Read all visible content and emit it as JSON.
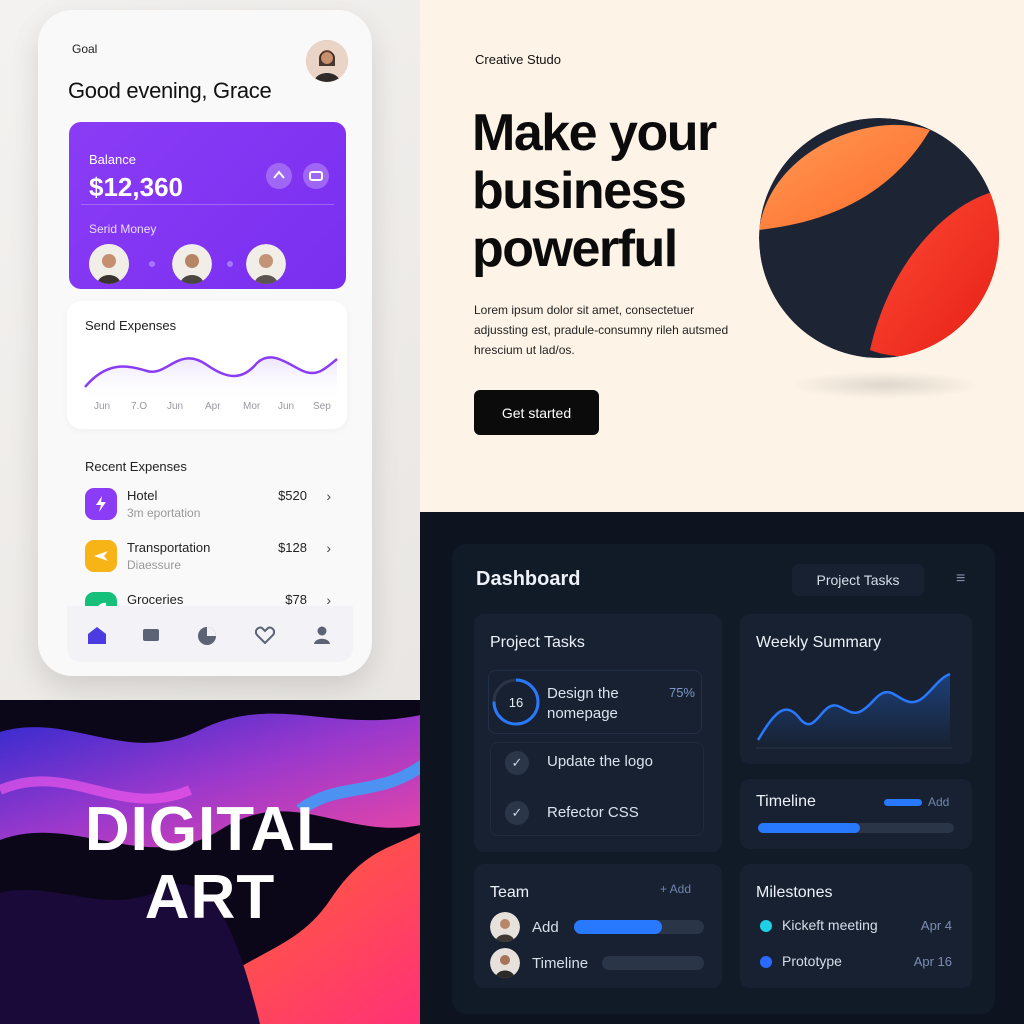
{
  "mobile": {
    "goal": "Goal",
    "greeting": "Good evening, Grace",
    "balance": {
      "label": "Balance",
      "value": "$12,360",
      "send_label": "Serid Money"
    },
    "expenses_chart": {
      "title": "Send Expenses",
      "months": [
        "Jun",
        "7.O",
        "Jun",
        "Apr",
        "Mor",
        "Jun",
        "Sep"
      ]
    },
    "recent": {
      "title": "Recent Expenses",
      "items": [
        {
          "name": "Hotel",
          "sub": "3m  eportation",
          "amount": "$520",
          "icon": "bolt-icon",
          "color": "#8b3cf7"
        },
        {
          "name": "Transportation",
          "sub": "Diaessure",
          "amount": "$128",
          "icon": "plane-icon",
          "color": "#f7b416"
        },
        {
          "name": "Groceries",
          "sub": "",
          "amount": "$78",
          "icon": "leaf-icon",
          "color": "#17c07a"
        }
      ]
    },
    "nav": [
      "home-icon",
      "wallet-icon",
      "chart-icon",
      "heart-icon",
      "profile-icon"
    ]
  },
  "hero": {
    "studio": "Creative Studo",
    "headline": [
      "Make your",
      "business",
      "powerful"
    ],
    "body": "Lorem ipsum dolor sit amet, consectetuer adjussting est, pradule-consumny rileh autsmed hrescium ut lad/os.",
    "cta": "Get started"
  },
  "art": {
    "line1": "DIGITAL",
    "line2": "ART"
  },
  "dashboard": {
    "title": "Dashboard",
    "tab": "Project Tasks",
    "tasks": {
      "title": "Project Tasks",
      "items": [
        {
          "ring": "16",
          "text1": "Design the",
          "text2": "nomepage",
          "pct": "75%"
        },
        {
          "text": "Update the logo"
        },
        {
          "text": "Refector CSS"
        }
      ]
    },
    "weekly": {
      "title": "Weekly Summary"
    },
    "timeline": {
      "title": "Timeline",
      "add": "Add",
      "progress": 0.52
    },
    "team": {
      "title": "Team",
      "add": "+ Add",
      "members": [
        {
          "name": "Add",
          "progress": 0.68
        },
        {
          "name": "Timeline",
          "progress": 0.0
        }
      ]
    },
    "milestones": {
      "title": "Milestones",
      "items": [
        {
          "name": "Kickeft meeting",
          "date": "Apr 4",
          "color": "#1fd1e6"
        },
        {
          "name": "Prototype",
          "date": "Apr 16",
          "color": "#2a6bff"
        }
      ]
    }
  },
  "colors": {
    "purple": "#7a2ff0",
    "accent_blue": "#2979ff",
    "hero_bg": "#fdf4e7",
    "dash_bg": "#0d1420"
  }
}
